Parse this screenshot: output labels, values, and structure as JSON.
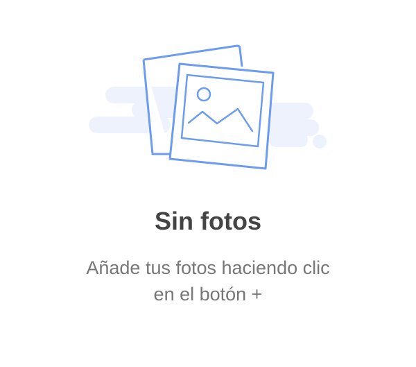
{
  "empty_state": {
    "illustration_icon": "photos-stack-icon",
    "title": "Sin fotos",
    "message_line_1": "Añade tus fotos haciendo clic",
    "message_line_2": "en el botón +"
  },
  "colors": {
    "accent": "#6b9cf0",
    "cloud": "#edf2fc",
    "title": "#444444",
    "message": "#777777",
    "background": "#ffffff"
  }
}
